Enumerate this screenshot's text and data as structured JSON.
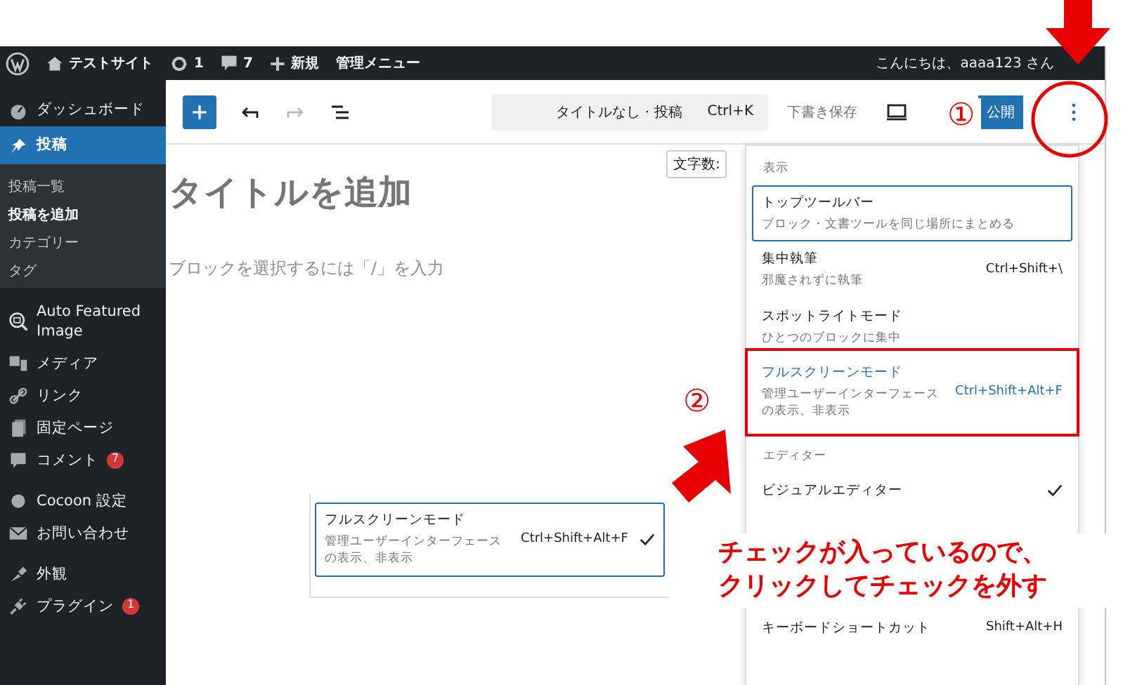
{
  "admin_bar": {
    "items": [
      {
        "kind": "logo"
      },
      {
        "kind": "home",
        "label": "テストサイト"
      },
      {
        "kind": "updates",
        "label": "1"
      },
      {
        "kind": "comments",
        "label": "7"
      },
      {
        "kind": "new",
        "label": "新規"
      },
      {
        "kind": "text",
        "label": "管理メニュー"
      }
    ],
    "greeting": "こんにちは、aaaa123 さん"
  },
  "sidebar": {
    "items": [
      {
        "kind": "dashboard",
        "label": "ダッシュボード",
        "selected": false
      },
      {
        "kind": "pin",
        "label": "投稿",
        "selected": true,
        "children": [
          {
            "label": "投稿一覧",
            "selected": false
          },
          {
            "label": "投稿を追加",
            "selected": true
          },
          {
            "label": "カテゴリー",
            "selected": false
          },
          {
            "label": "タグ",
            "selected": false
          }
        ]
      },
      {
        "kind": "image-search",
        "label": "Auto Featured Image",
        "selected": false
      },
      {
        "kind": "media",
        "label": "メディア",
        "selected": false
      },
      {
        "kind": "link",
        "label": "リンク",
        "selected": false
      },
      {
        "kind": "page",
        "label": "固定ページ",
        "selected": false
      },
      {
        "kind": "comment",
        "label": "コメント",
        "selected": false,
        "badge": "7"
      },
      {
        "kind": "dot",
        "label": "Cocoon 設定",
        "selected": false
      },
      {
        "kind": "mail",
        "label": "お問い合わせ",
        "selected": false
      },
      {
        "kind": "brush",
        "label": "外観",
        "selected": false
      },
      {
        "kind": "plug",
        "label": "プラグイン",
        "selected": false,
        "badge": "1"
      }
    ]
  },
  "toolbar": {
    "document_title": "タイトルなし · 投稿",
    "shortcut": "Ctrl+K",
    "save_draft": "下書き保存",
    "publish": "公開"
  },
  "editor": {
    "title_placeholder": "タイトルを追加",
    "block_placeholder": "ブロックを選択するには「/」を入力",
    "word_count": "文字数:"
  },
  "menu": {
    "sections": [
      {
        "heading": "表示",
        "items": [
          {
            "label": "トップツールバー",
            "description": "ブロック・文書ツールを同じ場所にまとめる",
            "focused": true,
            "highlighted": false,
            "checked": false
          },
          {
            "label": "集中執筆",
            "description": "邪魔されずに執筆",
            "shortcut": "Ctrl+Shift+\\",
            "focused": false,
            "highlighted": false,
            "checked": false
          },
          {
            "label": "スポットライトモード",
            "description": "ひとつのブロックに集中",
            "focused": false,
            "highlighted": false,
            "checked": false
          },
          {
            "label": "フルスクリーンモード",
            "description": "管理ユーザーインターフェースの表示、非表示",
            "shortcut": "Ctrl+Shift+Alt+F",
            "focused": false,
            "highlighted": true,
            "checked": false,
            "annotation_box": true
          }
        ]
      },
      {
        "heading": "エディター",
        "items": [
          {
            "label": "ビジュアルエディター",
            "focused": false,
            "highlighted": false,
            "checked": true
          }
        ]
      },
      {
        "items": [
          {
            "label": "キーボードショートカット",
            "shortcut": "Shift+Alt+H",
            "focused": false,
            "highlighted": false,
            "checked": false
          }
        ]
      }
    ]
  },
  "inset": {
    "label": "フルスクリーンモード",
    "description": "管理ユーザーインターフェースの表示、非表示",
    "shortcut": "Ctrl+Shift+Alt+F",
    "checked": true
  },
  "annotations": {
    "step_1": "①",
    "step_2": "②",
    "note_lines": [
      "チェックが入っているので、",
      "クリックしてチェックを外す"
    ]
  }
}
